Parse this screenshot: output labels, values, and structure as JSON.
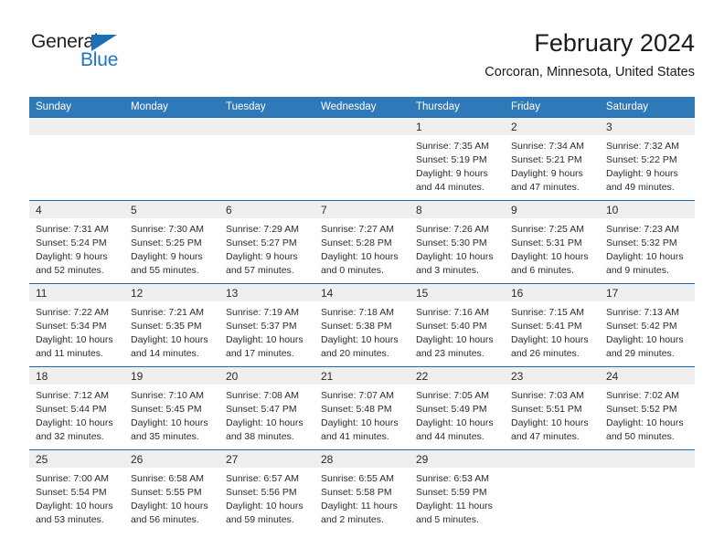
{
  "brand": {
    "name_top": "General",
    "name_bottom": "Blue",
    "triangle_icon": "blue-triangle-logo-mark",
    "color_dark": "#231f20",
    "color_blue": "#1c76c4"
  },
  "header": {
    "title": "February 2024",
    "subtitle": "Corcoran, Minnesota, United States"
  },
  "theme": {
    "header_blue": "#3079b9",
    "row_rule_blue": "#1f6cad",
    "daynum_band_gray": "#efefef"
  },
  "calendar": {
    "weekday_headers": [
      "Sunday",
      "Monday",
      "Tuesday",
      "Wednesday",
      "Thursday",
      "Friday",
      "Saturday"
    ],
    "weeks": [
      [
        {
          "day": "",
          "lines": []
        },
        {
          "day": "",
          "lines": []
        },
        {
          "day": "",
          "lines": []
        },
        {
          "day": "",
          "lines": []
        },
        {
          "day": "1",
          "lines": [
            "Sunrise: 7:35 AM",
            "Sunset: 5:19 PM",
            "Daylight: 9 hours",
            "and 44 minutes."
          ]
        },
        {
          "day": "2",
          "lines": [
            "Sunrise: 7:34 AM",
            "Sunset: 5:21 PM",
            "Daylight: 9 hours",
            "and 47 minutes."
          ]
        },
        {
          "day": "3",
          "lines": [
            "Sunrise: 7:32 AM",
            "Sunset: 5:22 PM",
            "Daylight: 9 hours",
            "and 49 minutes."
          ]
        }
      ],
      [
        {
          "day": "4",
          "lines": [
            "Sunrise: 7:31 AM",
            "Sunset: 5:24 PM",
            "Daylight: 9 hours",
            "and 52 minutes."
          ]
        },
        {
          "day": "5",
          "lines": [
            "Sunrise: 7:30 AM",
            "Sunset: 5:25 PM",
            "Daylight: 9 hours",
            "and 55 minutes."
          ]
        },
        {
          "day": "6",
          "lines": [
            "Sunrise: 7:29 AM",
            "Sunset: 5:27 PM",
            "Daylight: 9 hours",
            "and 57 minutes."
          ]
        },
        {
          "day": "7",
          "lines": [
            "Sunrise: 7:27 AM",
            "Sunset: 5:28 PM",
            "Daylight: 10 hours",
            "and 0 minutes."
          ]
        },
        {
          "day": "8",
          "lines": [
            "Sunrise: 7:26 AM",
            "Sunset: 5:30 PM",
            "Daylight: 10 hours",
            "and 3 minutes."
          ]
        },
        {
          "day": "9",
          "lines": [
            "Sunrise: 7:25 AM",
            "Sunset: 5:31 PM",
            "Daylight: 10 hours",
            "and 6 minutes."
          ]
        },
        {
          "day": "10",
          "lines": [
            "Sunrise: 7:23 AM",
            "Sunset: 5:32 PM",
            "Daylight: 10 hours",
            "and 9 minutes."
          ]
        }
      ],
      [
        {
          "day": "11",
          "lines": [
            "Sunrise: 7:22 AM",
            "Sunset: 5:34 PM",
            "Daylight: 10 hours",
            "and 11 minutes."
          ]
        },
        {
          "day": "12",
          "lines": [
            "Sunrise: 7:21 AM",
            "Sunset: 5:35 PM",
            "Daylight: 10 hours",
            "and 14 minutes."
          ]
        },
        {
          "day": "13",
          "lines": [
            "Sunrise: 7:19 AM",
            "Sunset: 5:37 PM",
            "Daylight: 10 hours",
            "and 17 minutes."
          ]
        },
        {
          "day": "14",
          "lines": [
            "Sunrise: 7:18 AM",
            "Sunset: 5:38 PM",
            "Daylight: 10 hours",
            "and 20 minutes."
          ]
        },
        {
          "day": "15",
          "lines": [
            "Sunrise: 7:16 AM",
            "Sunset: 5:40 PM",
            "Daylight: 10 hours",
            "and 23 minutes."
          ]
        },
        {
          "day": "16",
          "lines": [
            "Sunrise: 7:15 AM",
            "Sunset: 5:41 PM",
            "Daylight: 10 hours",
            "and 26 minutes."
          ]
        },
        {
          "day": "17",
          "lines": [
            "Sunrise: 7:13 AM",
            "Sunset: 5:42 PM",
            "Daylight: 10 hours",
            "and 29 minutes."
          ]
        }
      ],
      [
        {
          "day": "18",
          "lines": [
            "Sunrise: 7:12 AM",
            "Sunset: 5:44 PM",
            "Daylight: 10 hours",
            "and 32 minutes."
          ]
        },
        {
          "day": "19",
          "lines": [
            "Sunrise: 7:10 AM",
            "Sunset: 5:45 PM",
            "Daylight: 10 hours",
            "and 35 minutes."
          ]
        },
        {
          "day": "20",
          "lines": [
            "Sunrise: 7:08 AM",
            "Sunset: 5:47 PM",
            "Daylight: 10 hours",
            "and 38 minutes."
          ]
        },
        {
          "day": "21",
          "lines": [
            "Sunrise: 7:07 AM",
            "Sunset: 5:48 PM",
            "Daylight: 10 hours",
            "and 41 minutes."
          ]
        },
        {
          "day": "22",
          "lines": [
            "Sunrise: 7:05 AM",
            "Sunset: 5:49 PM",
            "Daylight: 10 hours",
            "and 44 minutes."
          ]
        },
        {
          "day": "23",
          "lines": [
            "Sunrise: 7:03 AM",
            "Sunset: 5:51 PM",
            "Daylight: 10 hours",
            "and 47 minutes."
          ]
        },
        {
          "day": "24",
          "lines": [
            "Sunrise: 7:02 AM",
            "Sunset: 5:52 PM",
            "Daylight: 10 hours",
            "and 50 minutes."
          ]
        }
      ],
      [
        {
          "day": "25",
          "lines": [
            "Sunrise: 7:00 AM",
            "Sunset: 5:54 PM",
            "Daylight: 10 hours",
            "and 53 minutes."
          ]
        },
        {
          "day": "26",
          "lines": [
            "Sunrise: 6:58 AM",
            "Sunset: 5:55 PM",
            "Daylight: 10 hours",
            "and 56 minutes."
          ]
        },
        {
          "day": "27",
          "lines": [
            "Sunrise: 6:57 AM",
            "Sunset: 5:56 PM",
            "Daylight: 10 hours",
            "and 59 minutes."
          ]
        },
        {
          "day": "28",
          "lines": [
            "Sunrise: 6:55 AM",
            "Sunset: 5:58 PM",
            "Daylight: 11 hours",
            "and 2 minutes."
          ]
        },
        {
          "day": "29",
          "lines": [
            "Sunrise: 6:53 AM",
            "Sunset: 5:59 PM",
            "Daylight: 11 hours",
            "and 5 minutes."
          ]
        },
        {
          "day": "",
          "lines": []
        },
        {
          "day": "",
          "lines": []
        }
      ]
    ]
  }
}
